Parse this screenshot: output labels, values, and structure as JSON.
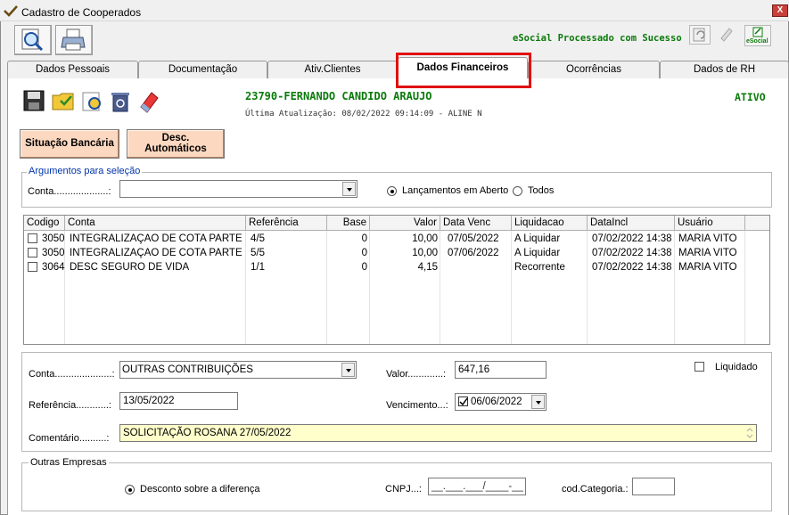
{
  "window": {
    "title": "Cadastro de Cooperados",
    "close_label": "X"
  },
  "toolbar": {
    "search_icon": "search-magnifier-icon",
    "print_icon": "printer-icon"
  },
  "esocial": {
    "status": "eSocial Processado com Sucesso",
    "badge_label": "eSocial"
  },
  "tabs": [
    {
      "label": "Dados Pessoais"
    },
    {
      "label": "Documentação"
    },
    {
      "label": "Ativ.Clientes"
    },
    {
      "label": "Dados Financeiros"
    },
    {
      "label": "Ocorrências"
    },
    {
      "label": "Dados de RH"
    }
  ],
  "record": {
    "title": "23790-FERNANDO CANDIDO ARAUJO",
    "last_update": "Última Atualização: 08/02/2022 09:14:09 - ALINE N",
    "status": "ATIVO"
  },
  "buttons": {
    "bank_status": "Situação Bancária",
    "auto_discounts_line1": "Desc.",
    "auto_discounts_line2": "Automáticos"
  },
  "filter": {
    "legend": "Argumentos para seleção",
    "conta_label": "Conta....................:",
    "conta_value": "",
    "option_open": "Lançamentos em Aberto",
    "option_all": "Todos",
    "selected": "open"
  },
  "grid": {
    "columns": [
      "Codigo",
      "Conta",
      "Referência",
      "Base",
      "Valor",
      "Data Venc",
      "Liquidacao",
      "DataIncl",
      "Usuário"
    ],
    "rows": [
      {
        "codigo": "3050",
        "conta": "INTEGRALIZAÇAO DE COTA PARTE",
        "referencia": "4/5",
        "base": "0",
        "valor": "10,00",
        "data_venc": "07/05/2022",
        "liquidacao": "A Liquidar",
        "data_incl": "07/02/2022 14:38",
        "usuario": "MARIA VITO"
      },
      {
        "codigo": "3050",
        "conta": "INTEGRALIZAÇAO DE COTA PARTE",
        "referencia": "5/5",
        "base": "0",
        "valor": "10,00",
        "data_venc": "07/06/2022",
        "liquidacao": "A Liquidar",
        "data_incl": "07/02/2022 14:38",
        "usuario": "MARIA VITO"
      },
      {
        "codigo": "3064",
        "conta": "DESC SEGURO DE VIDA",
        "referencia": "1/1",
        "base": "0",
        "valor": "4,15",
        "data_venc": "",
        "liquidacao": "Recorrente",
        "data_incl": "07/02/2022 14:38",
        "usuario": "MARIA VITO"
      }
    ]
  },
  "form": {
    "conta_label": "Conta.....................:",
    "conta_value": "OUTRAS CONTRIBUIÇÕES",
    "valor_label": "Valor.............:",
    "valor_value": "647,16",
    "liquidado_label": "Liquidado",
    "referencia_label": "Referência............:",
    "referencia_value": "13/05/2022",
    "vencimento_label": "Vencimento...:",
    "vencimento_value": "06/06/2022",
    "comentario_label": "Comentário..........:",
    "comentario_value": "SOLICITAÇÃO ROSANA 27/05/2022"
  },
  "outras_empresas": {
    "legend": "Outras Empresas",
    "desconto_label": "Desconto sobre a diferença",
    "cnpj_label": "CNPJ...:",
    "cnpj_placeholder": "__.___.___/____-__",
    "cod_categoria_label": "cod.Categoria.:",
    "cod_categoria_value": ""
  },
  "colors": {
    "green_text": "#0a7a0a",
    "highlight_red": "#e01010",
    "action_button": "#fcd8c0",
    "comment_bg": "#ffffcc"
  }
}
